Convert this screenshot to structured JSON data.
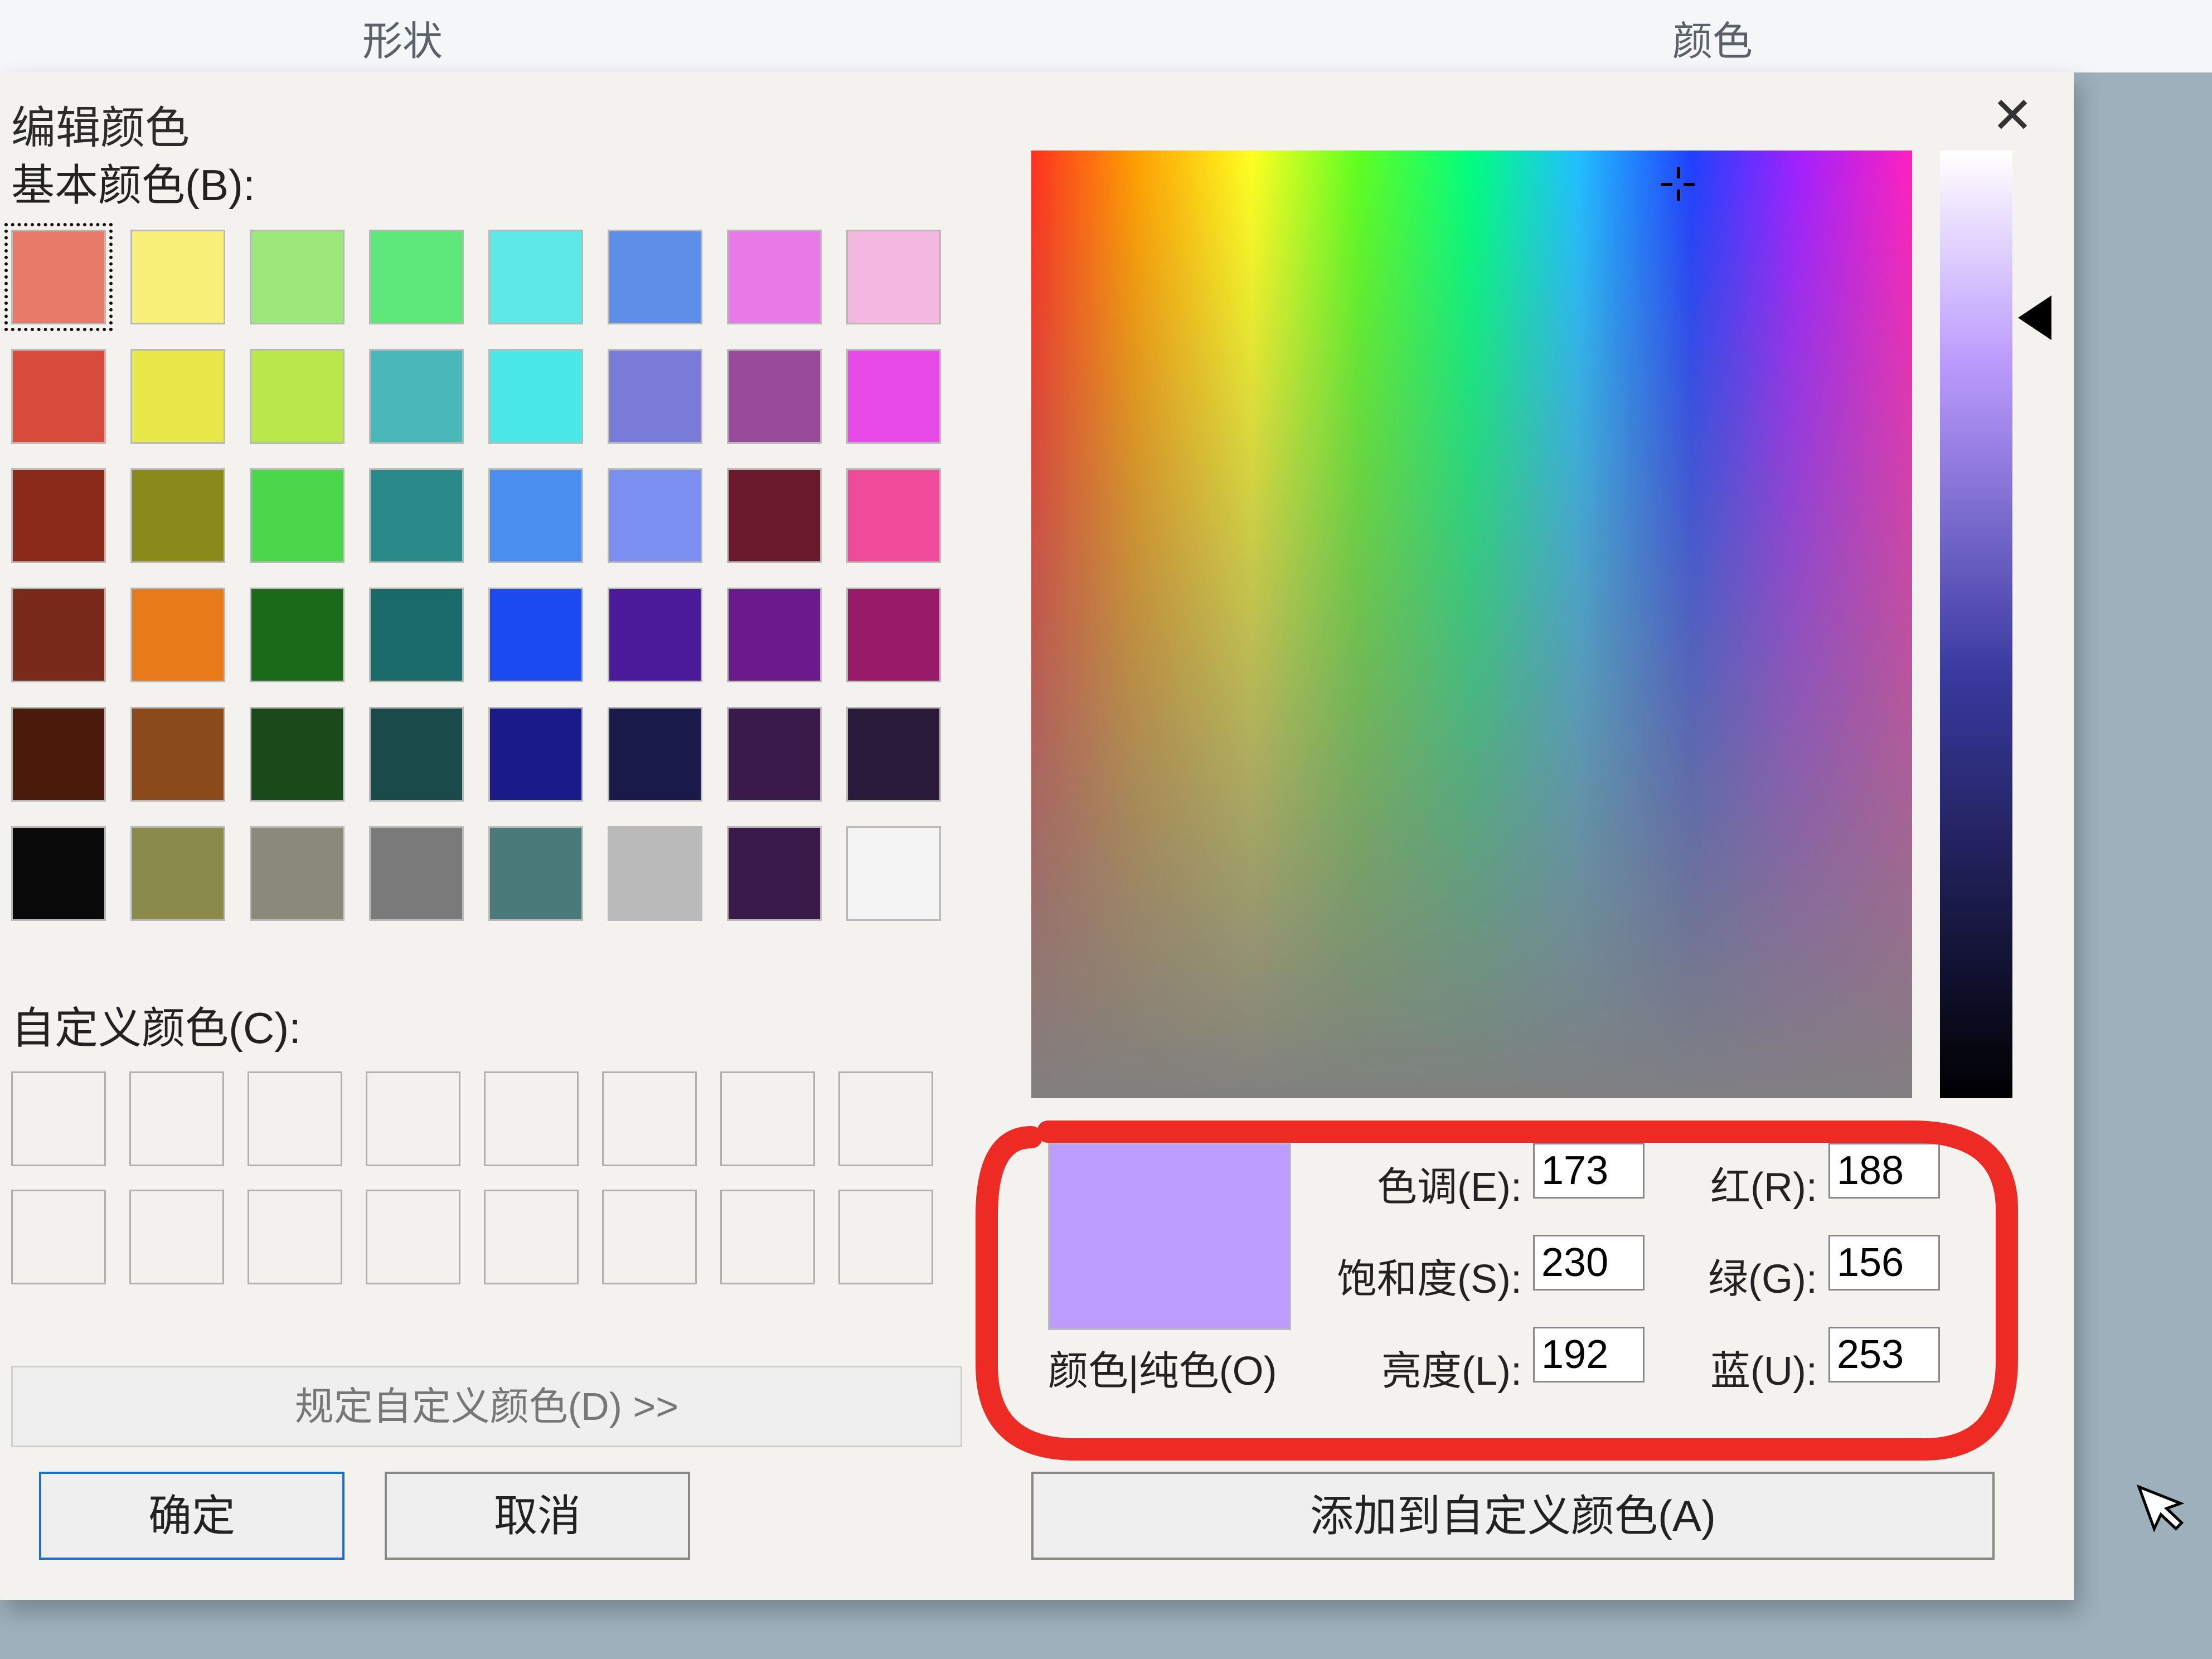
{
  "backgroundTabs": {
    "shapes": "形状",
    "colors": "颜色"
  },
  "dialog": {
    "title": "编辑颜色",
    "basicLabel": "基本颜色(B):",
    "customLabel": "自定义颜色(C):",
    "defineButton": "规定自定义颜色(D) >>",
    "okButton": "确定",
    "cancelButton": "取消",
    "addButton": "添加到自定义颜色(A)",
    "fields": {
      "hueLabel": "色调(E):",
      "hueValue": "173",
      "satLabel": "饱和度(S):",
      "satValue": "230",
      "lumLabel": "亮度(L):",
      "lumValue": "192",
      "redLabel": "红(R):",
      "redValue": "188",
      "greenLabel": "绿(G):",
      "greenValue": "156",
      "blueLabel": "蓝(U):",
      "blueValue": "253"
    },
    "previewLabel": "颜色|纯色(O)",
    "previewColor": "#bc9cfd",
    "basicColors": [
      "#e87a6a",
      "#f9f07a",
      "#9ce87a",
      "#5ee87a",
      "#5ee8e8",
      "#5e8fe8",
      "#e87ae8",
      "#f4b7e0",
      "#d84a3a",
      "#e8e84a",
      "#b8e84a",
      "#4ab8b8",
      "#4ae8e8",
      "#7a7ad8",
      "#9a4a9a",
      "#e84ae8",
      "#8a2a1a",
      "#8a8a1a",
      "#4ad84a",
      "#2a8a8a",
      "#4a8ff0",
      "#7a8ff0",
      "#6a1a2a",
      "#f04a9a",
      "#7a2a1a",
      "#e87a1a",
      "#1a6a1a",
      "#1a6a6a",
      "#1a4af0",
      "#4a1a9a",
      "#6a1a8a",
      "#9a1a6a",
      "#4a1a0a",
      "#8a4a1a",
      "#1a4a1a",
      "#1a4a4a",
      "#1a1a8a",
      "#1a1a4a",
      "#3a1a4a",
      "#2a1a3a",
      "#0a0a0a",
      "#8a8a4a",
      "#8a8a7a",
      "#7a7a7a",
      "#4a7a7a",
      "#bababa",
      "#3a1a4a",
      "#f4f4f4"
    ]
  }
}
